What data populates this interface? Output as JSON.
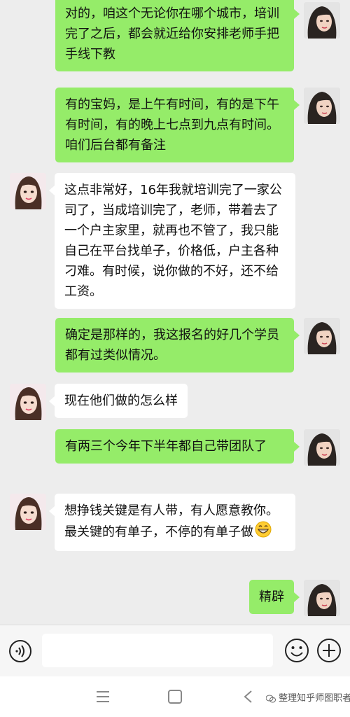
{
  "messages": [
    {
      "sender": "self",
      "text": "对的，咱这个无论你在哪个城市，培训完了之后，都会就近给你安排老师手把手线下教"
    },
    {
      "sender": "self",
      "text": "有的宝妈，是上午有时间，有的是下午有时间，有的晚上七点到九点有时间。咱们后台都有备注"
    },
    {
      "sender": "other",
      "text": "这点非常好，16年我就培训完了一家公司了，当成培训完了，老师，带着去了一个户主家里，就再也不管了，我只能自己在平台找单子，价格低，户主各种刁难。有时候，说你做的不好，还不给工资。"
    },
    {
      "sender": "self",
      "text": "确定是那样的，我这报名的好几个学员都有过类似情况。"
    },
    {
      "sender": "other",
      "text": "现在他们做的怎么样"
    },
    {
      "sender": "self",
      "text": "有两三个今年下半年都自己带团队了"
    },
    {
      "sender": "other",
      "text": "想挣钱关键是有人带，有人愿意教你。最关键的有单子，不停的有单子做",
      "emoji": "grin-emoji"
    },
    {
      "sender": "self",
      "text": "精辟"
    }
  ],
  "input_bar": {
    "voice_icon": "voice-icon",
    "emoji_icon": "smiley-icon",
    "plus_icon": "plus-icon"
  },
  "nav_bar": {
    "menu_icon": "menu-icon",
    "home_icon": "home-icon",
    "back_icon": "back-icon"
  },
  "watermark": "整理知乎师图职者",
  "colors": {
    "background": "#ededed",
    "self_bubble": "#95ec69",
    "other_bubble": "#ffffff"
  }
}
